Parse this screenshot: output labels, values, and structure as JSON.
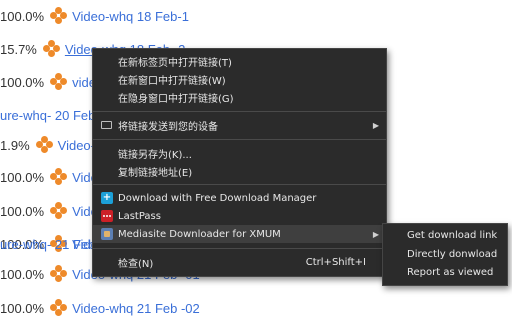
{
  "list": [
    {
      "pct": "100.0%",
      "title": "Video-whq 18 Feb-1",
      "icon": "orange-dots-icon"
    },
    {
      "pct": "15.7%",
      "title": "Video-whq 18 Feb -2",
      "icon": "orange-dots-icon"
    },
    {
      "pct": "100.0%",
      "title": "video",
      "icon": "orange-dots-icon"
    },
    {
      "pct": "",
      "title": "ure-whq- 20 Feb",
      "icon": ""
    },
    {
      "pct": "1.9%",
      "title": "Video-",
      "icon": "orange-dots-icon"
    },
    {
      "pct": "100.0%",
      "title": "Video-",
      "icon": "orange-dots-icon"
    },
    {
      "pct": "100.0%",
      "title": "Video-",
      "icon": "orange-dots-icon"
    },
    {
      "pct": "100.0%",
      "title": "Video-",
      "icon": "orange-dots-icon"
    },
    {
      "pct": "",
      "title": "ure-whq- 21 Feb",
      "icon": ""
    },
    {
      "pct": "100.0%",
      "title": "Video-whq 21 Feb -01",
      "icon": "orange-dots-icon"
    },
    {
      "pct": "100.0%",
      "title": "Video-whq 21 Feb -02",
      "icon": "orange-dots-icon"
    }
  ],
  "context_menu": {
    "open_new_tab": "在新标签页中打开链接(T)",
    "open_new_window": "在新窗口中打开链接(W)",
    "open_incognito": "在隐身窗口中打开链接(G)",
    "send_to_devices": "将链接发送到您的设备",
    "save_link_as": "链接另存为(K)...",
    "copy_link_address": "复制链接地址(E)",
    "download_fdm": "Download with Free Download Manager",
    "lastpass": "LastPass",
    "mediasite": "Mediasite Downloader for XMUM",
    "inspect": "检查(N)",
    "inspect_shortcut": "Ctrl+Shift+I",
    "submenu_arrow": "▶"
  },
  "submenu": {
    "get_download_link": "Get download link",
    "directly_download": "Directly donwload",
    "report_as_viewed": "Report as viewed"
  },
  "colors": {
    "link": "#3a6fd8",
    "orange_icon": "#ee8a2a",
    "menu_bg": "#2b2b2b",
    "menu_text": "#e8e8e8",
    "highlight": "#3f3f3f"
  }
}
